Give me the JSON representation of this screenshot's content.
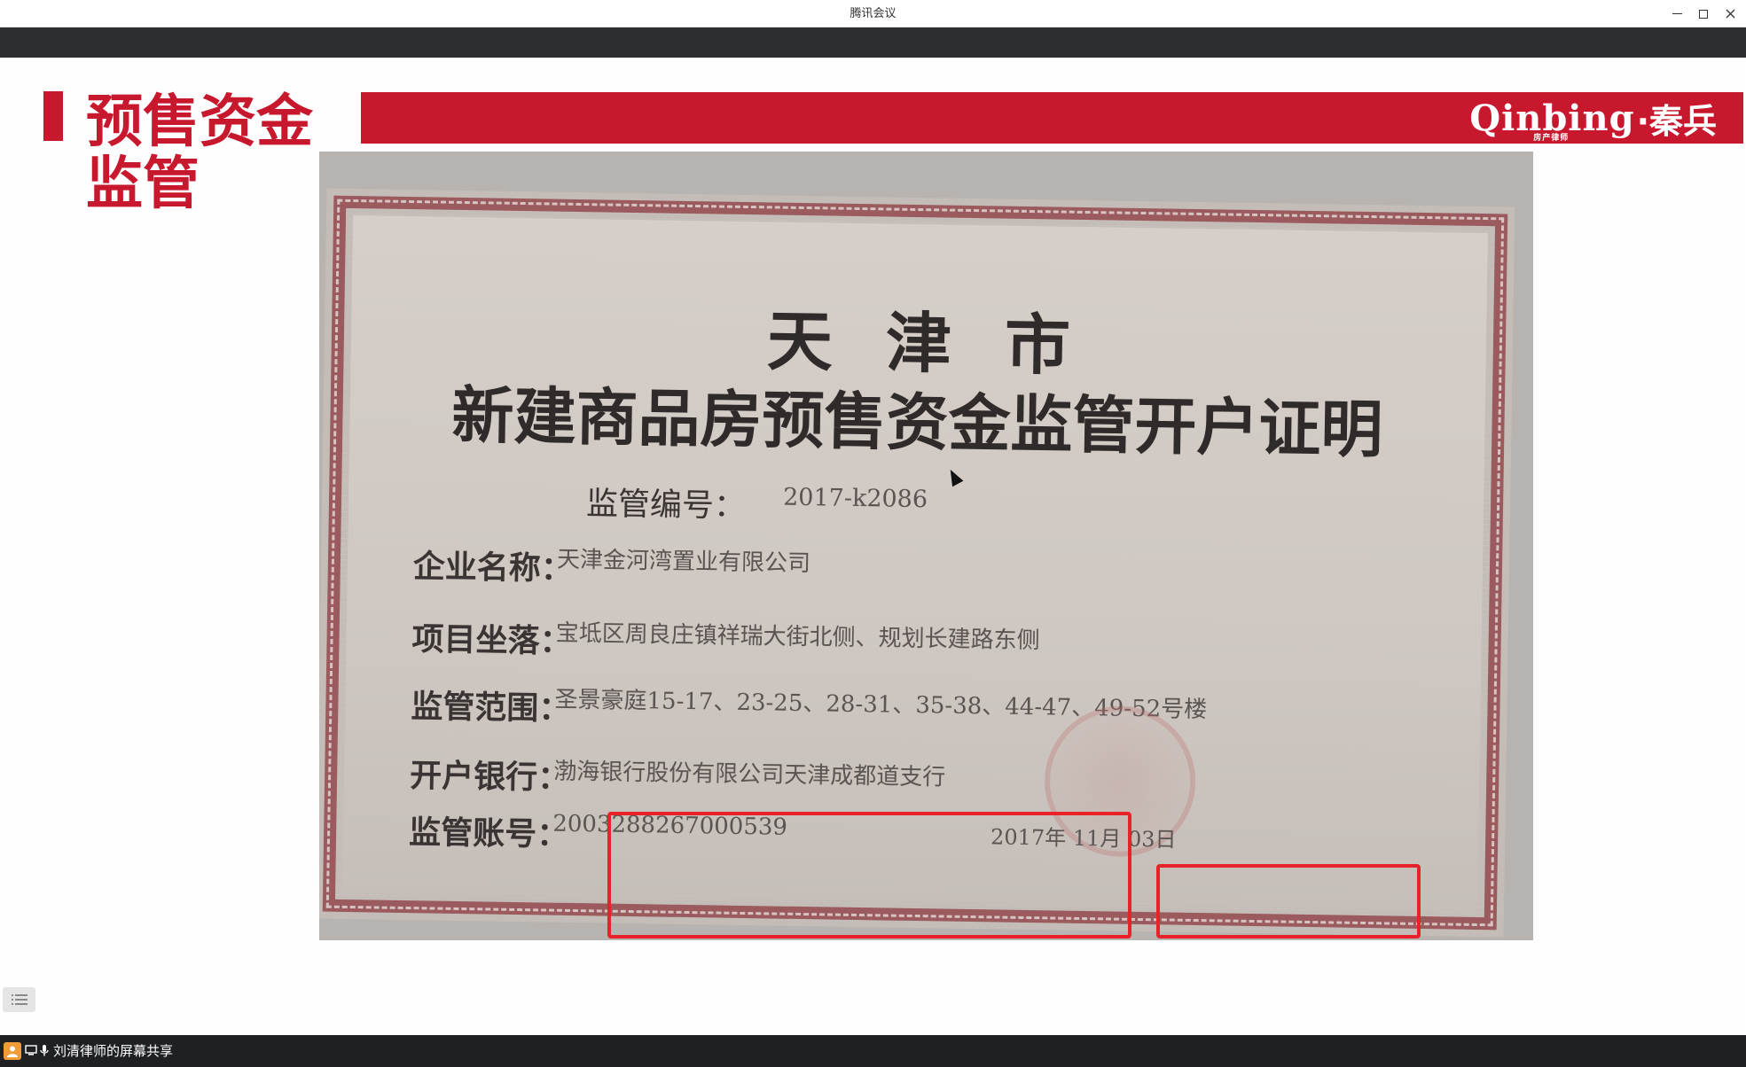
{
  "window": {
    "title": "腾讯会议"
  },
  "slide": {
    "title": "预售资金监管",
    "brand_latin": "Qinbing",
    "brand_sub": "房产律师",
    "brand_cn": "·秦兵"
  },
  "certificate": {
    "city": "天津市",
    "heading": "新建商品房预售资金监管开户证明",
    "fields": {
      "number_label": "监管编号：",
      "number_value": "2017-k2086",
      "company_label": "企业名称：",
      "company_value": "天津金河湾置业有限公司",
      "location_label": "项目坐落：",
      "location_value": "宝坻区周良庄镇祥瑞大街北侧、规划长建路东侧",
      "scope_label": "监管范围：",
      "scope_value": "圣景豪庭15-17、23-25、28-31、35-38、44-47、49-52号楼",
      "bank_label": "开户银行：",
      "bank_value": "渤海银行股份有限公司天津成都道支行",
      "account_label": "监管账号：",
      "account_value": "2003288267000539",
      "date_value": "2017年 11月 03日"
    },
    "highlight_color": "#e9222a"
  },
  "toolbar": {
    "icons": [
      "prev-slide-icon",
      "next-slide-icon",
      "pen-icon",
      "screenshot-icon",
      "camera-icon",
      "chat-icon",
      "more-icon"
    ]
  },
  "status": {
    "share_text": "刘清律师的屏幕共享"
  },
  "colors": {
    "brand_red": "#c8182e",
    "dark_bar": "#2c2d30",
    "status_bar": "#1f2023"
  }
}
